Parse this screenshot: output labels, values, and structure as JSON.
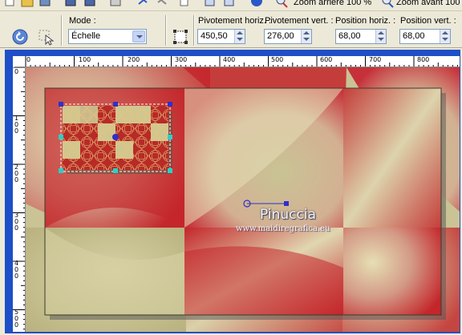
{
  "topstrip": {
    "zoom_out_label": "Zoom arrière 100 %",
    "zoom_in_label": "Zoom avant 100"
  },
  "toolbar": {
    "mode_label": "Mode :",
    "mode_value": "Échelle",
    "pivot_h_label": "Pivotement horiz. :",
    "pivot_h_value": "450,50",
    "pivot_v_label": "Pivotement vert. :",
    "pivot_v_value": "276,00",
    "pos_h_label": "Position horiz. :",
    "pos_h_value": "68,00",
    "pos_v_label": "Position vert. :",
    "pos_v_value": "68,00"
  },
  "ruler": {
    "top_labels": [
      "0",
      "100",
      "200",
      "300",
      "400",
      "500",
      "600",
      "700",
      "800"
    ],
    "left_labels": [
      "0",
      "100",
      "200",
      "300",
      "400",
      "500"
    ]
  },
  "watermark": {
    "name": "Pinuccia",
    "url": "www.maidiregrafica.eu"
  },
  "colors": {
    "accent_blue": "#1e4fc8",
    "red": "#c4262b",
    "cream": "#c9c395"
  },
  "icons": [
    "undo-icon",
    "select-icon",
    "deform-icon",
    "info-icon"
  ]
}
